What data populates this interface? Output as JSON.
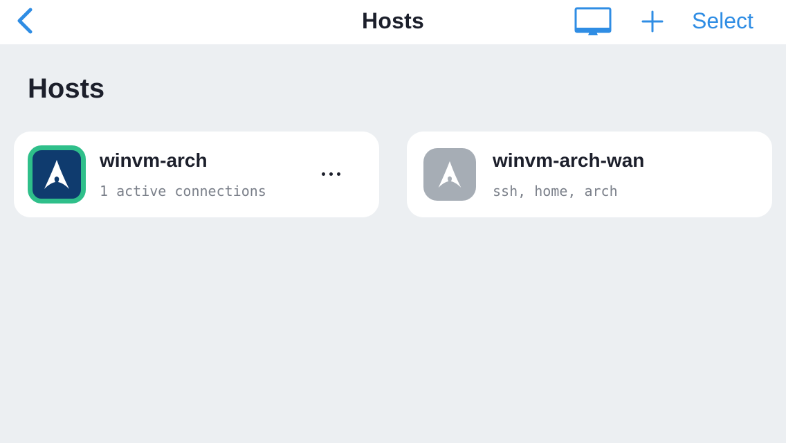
{
  "navbar": {
    "title": "Hosts",
    "select_label": "Select",
    "accent_color": "#2f8de4",
    "icons": [
      "chevron-left-icon",
      "monitor-icon",
      "plus-icon"
    ]
  },
  "section": {
    "title": "Hosts"
  },
  "hosts": [
    {
      "name": "winvm-arch",
      "subtitle": "1 active connections",
      "icon": "arch-linux-icon",
      "status": "active",
      "icon_bg": "#0f3b6e",
      "icon_border": "#2fbf8a"
    },
    {
      "name": "winvm-arch-wan",
      "subtitle": "ssh, home, arch",
      "icon": "arch-linux-icon",
      "status": "inactive",
      "icon_bg": "#a6adb5"
    }
  ]
}
